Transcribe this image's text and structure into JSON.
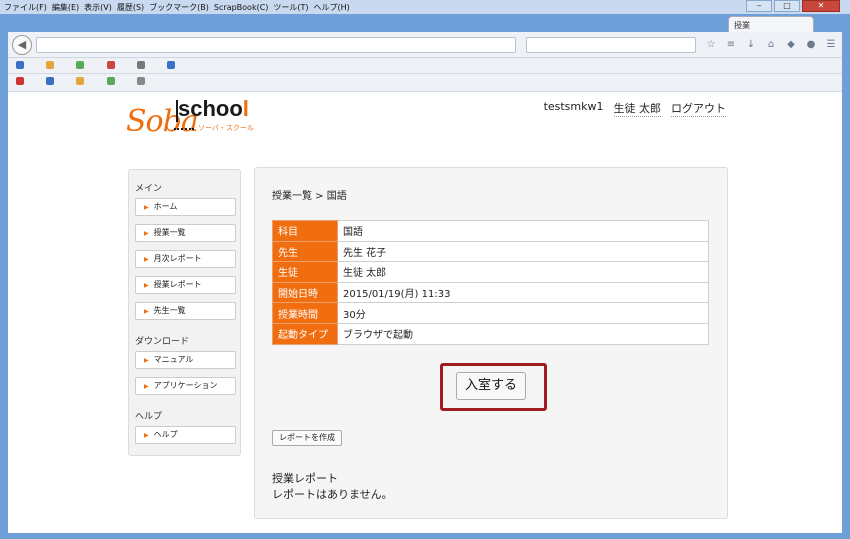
{
  "browser": {
    "menu": [
      "ファイル(F)",
      "編集(E)",
      "表示(V)",
      "履歴(S)",
      "ブックマーク(B)",
      "ScrapBook(C)",
      "ツール(T)",
      "ヘルプ(H)"
    ],
    "window_buttons": {
      "minimize": "‒",
      "maximize": "□",
      "close": "✕"
    },
    "tab_title": "授業",
    "url": "",
    "search_placeholder": "",
    "bookmarks_row1": [
      "",
      "",
      "",
      "",
      "",
      "",
      "",
      "",
      "",
      "",
      "",
      ""
    ],
    "bookmarks_row2": [
      "",
      "",
      "",
      "",
      "",
      "",
      "",
      "",
      "",
      "",
      "",
      ""
    ]
  },
  "site": {
    "logo_soba": "Soba",
    "logo_school": "schoo",
    "logo_school_last": "l",
    "logo_kana": "ソーバ・スクール"
  },
  "header": {
    "user_id": "testsmkw1",
    "user_name": "生徒 太郎",
    "logout": "ログアウト"
  },
  "sidebar": {
    "main_title": "メイン",
    "main_items": [
      "ホーム",
      "授業一覧",
      "月次レポート",
      "授業レポート",
      "先生一覧"
    ],
    "download_title": "ダウンロード",
    "download_items": [
      "マニュアル",
      "アプリケーション"
    ],
    "help_title": "ヘルプ",
    "help_items": [
      "ヘルプ"
    ]
  },
  "content": {
    "breadcrumb": "授業一覧 > 国語",
    "rows": [
      {
        "label": "科目",
        "value": "国語"
      },
      {
        "label": "先生",
        "value": "先生 花子"
      },
      {
        "label": "生徒",
        "value": "生徒 太郎"
      },
      {
        "label": "開始日時",
        "value": "2015/01/19(月) 11:33"
      },
      {
        "label": "授業時間",
        "value": "30分"
      },
      {
        "label": "起動タイプ",
        "value": "ブラウザで起動"
      }
    ],
    "enter_button": "入室する",
    "create_report_button": "レポートを作成",
    "report_title": "授業レポート",
    "report_empty": "レポートはありません。"
  },
  "colors": {
    "accent": "#f06e10",
    "highlight": "#a01c22"
  }
}
